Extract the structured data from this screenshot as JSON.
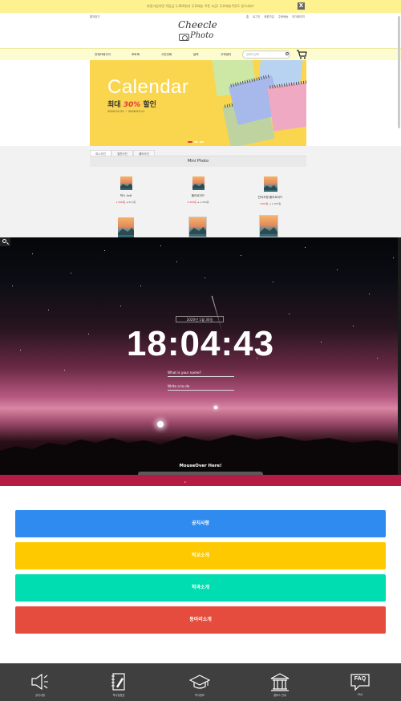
{
  "shop": {
    "promo_text": "회원가입하면 적립금 1,000원과 무료배송 쿠폰 지급! 무료배송쿠폰도 받으세요!",
    "close_label": "X",
    "favorite_label": "즐겨찾기",
    "util_links": [
      "홈",
      "로그인",
      "회원가입",
      "주문배송",
      "마이페이지"
    ],
    "logo_line1": "Cheecle",
    "logo_line2": "Photo",
    "nav_items": [
      "전체카테고리",
      "포토북",
      "사진인화",
      "달력",
      "고객센터"
    ],
    "search_placeholder": "검색어 입력",
    "banner": {
      "title": "Calendar",
      "sub_prefix": "최대",
      "sub_pct": "30%",
      "sub_suffix": "할인",
      "date": "2020.02.22 ~ 2026.03.11",
      "slide_count": 3,
      "active_slide": 1
    },
    "tabs": [
      "미니사진",
      "일반사진",
      "폴라사진"
    ],
    "active_tab": 0,
    "section_title": "Mini Photo",
    "products": [
      {
        "name": "박스 4x6",
        "old": "1,900원",
        "new": "4(?)원"
      },
      {
        "name": "폴라로이드",
        "old": "2,300원",
        "new": "1,200원"
      },
      {
        "name": "빈티지형 폴라로이드",
        "old": "3000원",
        "new": "1,050원"
      }
    ]
  },
  "night": {
    "date_chip": "2020년 1월 30일",
    "clock": "18:04:43",
    "name_field": "What is your name?",
    "todo_field": "Write a to-do",
    "mouseover_label": "MouseOver Here!"
  },
  "menu": {
    "buttons": [
      {
        "label": "공지사항",
        "color": "#2f8bf0"
      },
      {
        "label": "학교소개",
        "color": "#ffc900"
      },
      {
        "label": "학과소개",
        "color": "#00ddb0"
      },
      {
        "label": "동아리소개",
        "color": "#e64c3d"
      }
    ]
  },
  "bottom_nav": [
    {
      "label": "공지사항",
      "icon": "megaphone-icon"
    },
    {
      "label": "학사일정표",
      "icon": "notebook-pen-icon"
    },
    {
      "label": "학사정보",
      "icon": "graduation-cap-icon"
    },
    {
      "label": "캠퍼스 안내",
      "icon": "building-icon"
    },
    {
      "label": "FAQ",
      "icon": "faq-bubble-icon"
    }
  ]
}
